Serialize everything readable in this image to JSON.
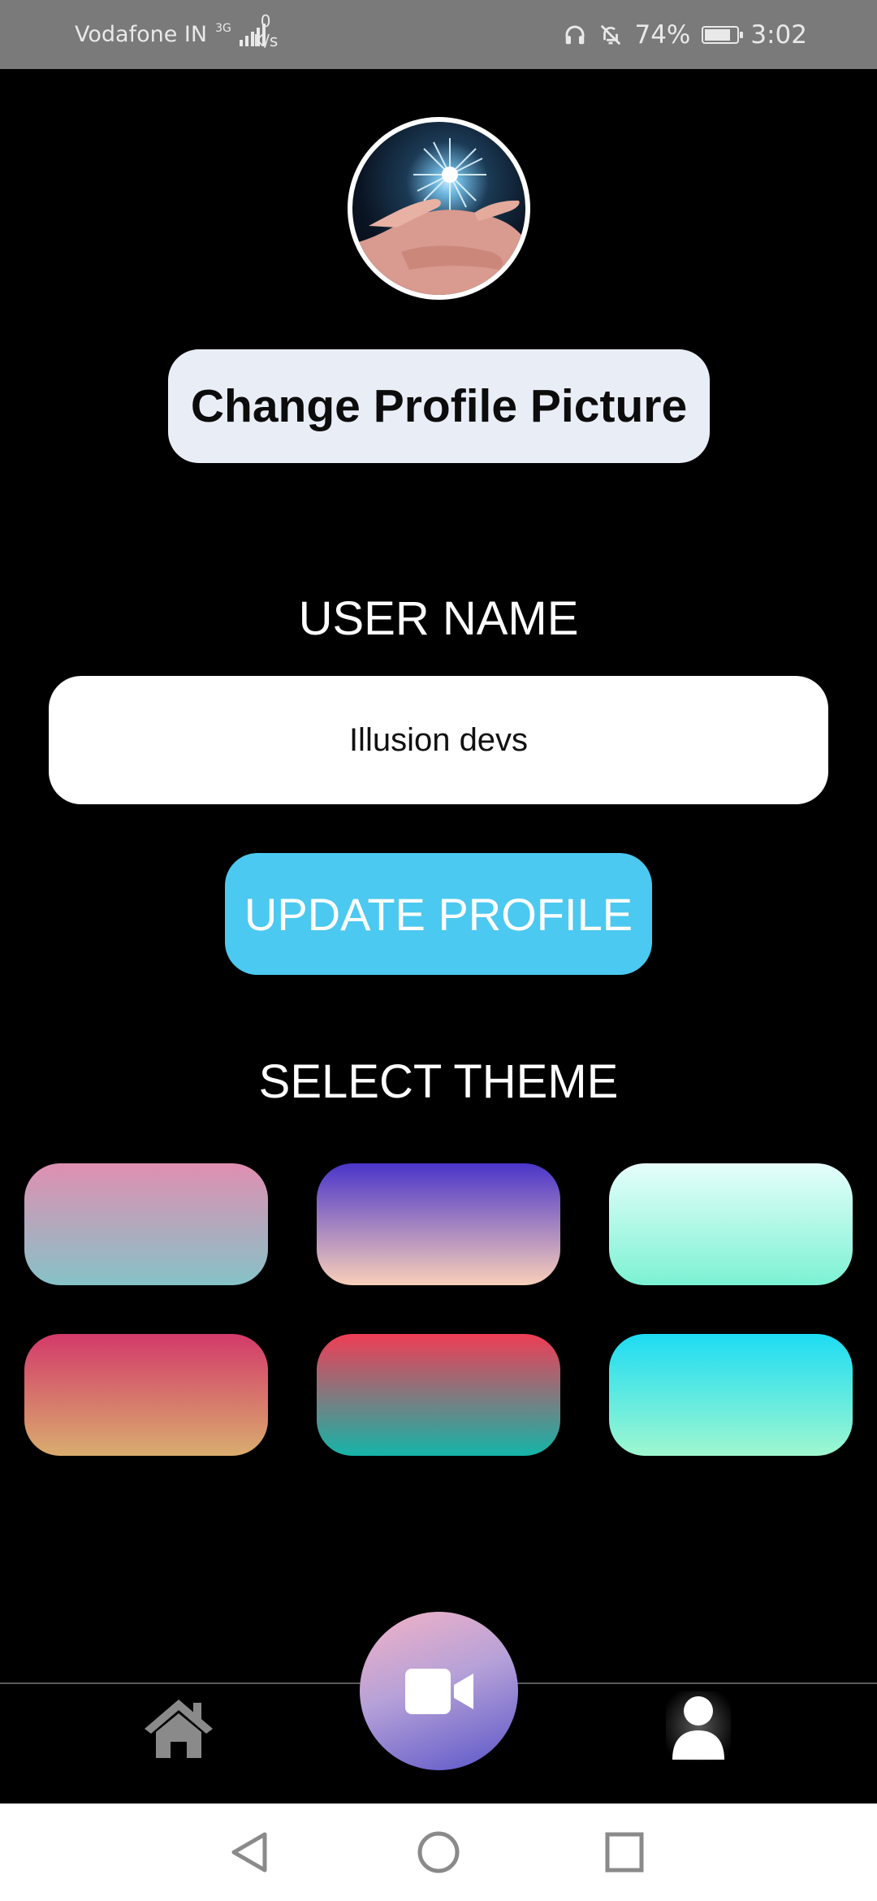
{
  "status_bar": {
    "carrier": "Vodafone IN",
    "network_type": "3G",
    "speed_value": "0",
    "speed_unit": "K/s",
    "battery_percent": "74%",
    "time": "3:02",
    "icons": [
      "headphones-icon",
      "bell-off-icon",
      "battery-charging-icon"
    ]
  },
  "profile": {
    "change_picture_label": "Change Profile Picture",
    "username_label": "USER NAME",
    "username_value": "Illusion devs",
    "update_label": "UPDATE PROFILE"
  },
  "theme": {
    "label": "SELECT THEME",
    "swatches": [
      {
        "top": "#e08fb1",
        "bottom": "#86c2c8"
      },
      {
        "top": "#4a35c9",
        "bottom": "#f9cfb9"
      },
      {
        "top": "#e6fefb",
        "bottom": "#7cf2d3"
      },
      {
        "top": "#d33a6a",
        "bottom": "#d9ac6e"
      },
      {
        "top": "#f03d55",
        "bottom": "#14b5a8"
      },
      {
        "top": "#1ddcf3",
        "bottom": "#9ff7cf"
      }
    ]
  },
  "bottom_nav": {
    "items": [
      "home-icon",
      "video-camera-icon",
      "user-icon"
    ],
    "active": "user-icon"
  },
  "system_nav": [
    "back-icon",
    "home-circle-icon",
    "recents-icon"
  ],
  "colors": {
    "accent": "#4cc9f0",
    "button_light": "#e9eef6",
    "status_bar": "#7a7a7a",
    "inactive_icon": "#8a8a8a"
  }
}
